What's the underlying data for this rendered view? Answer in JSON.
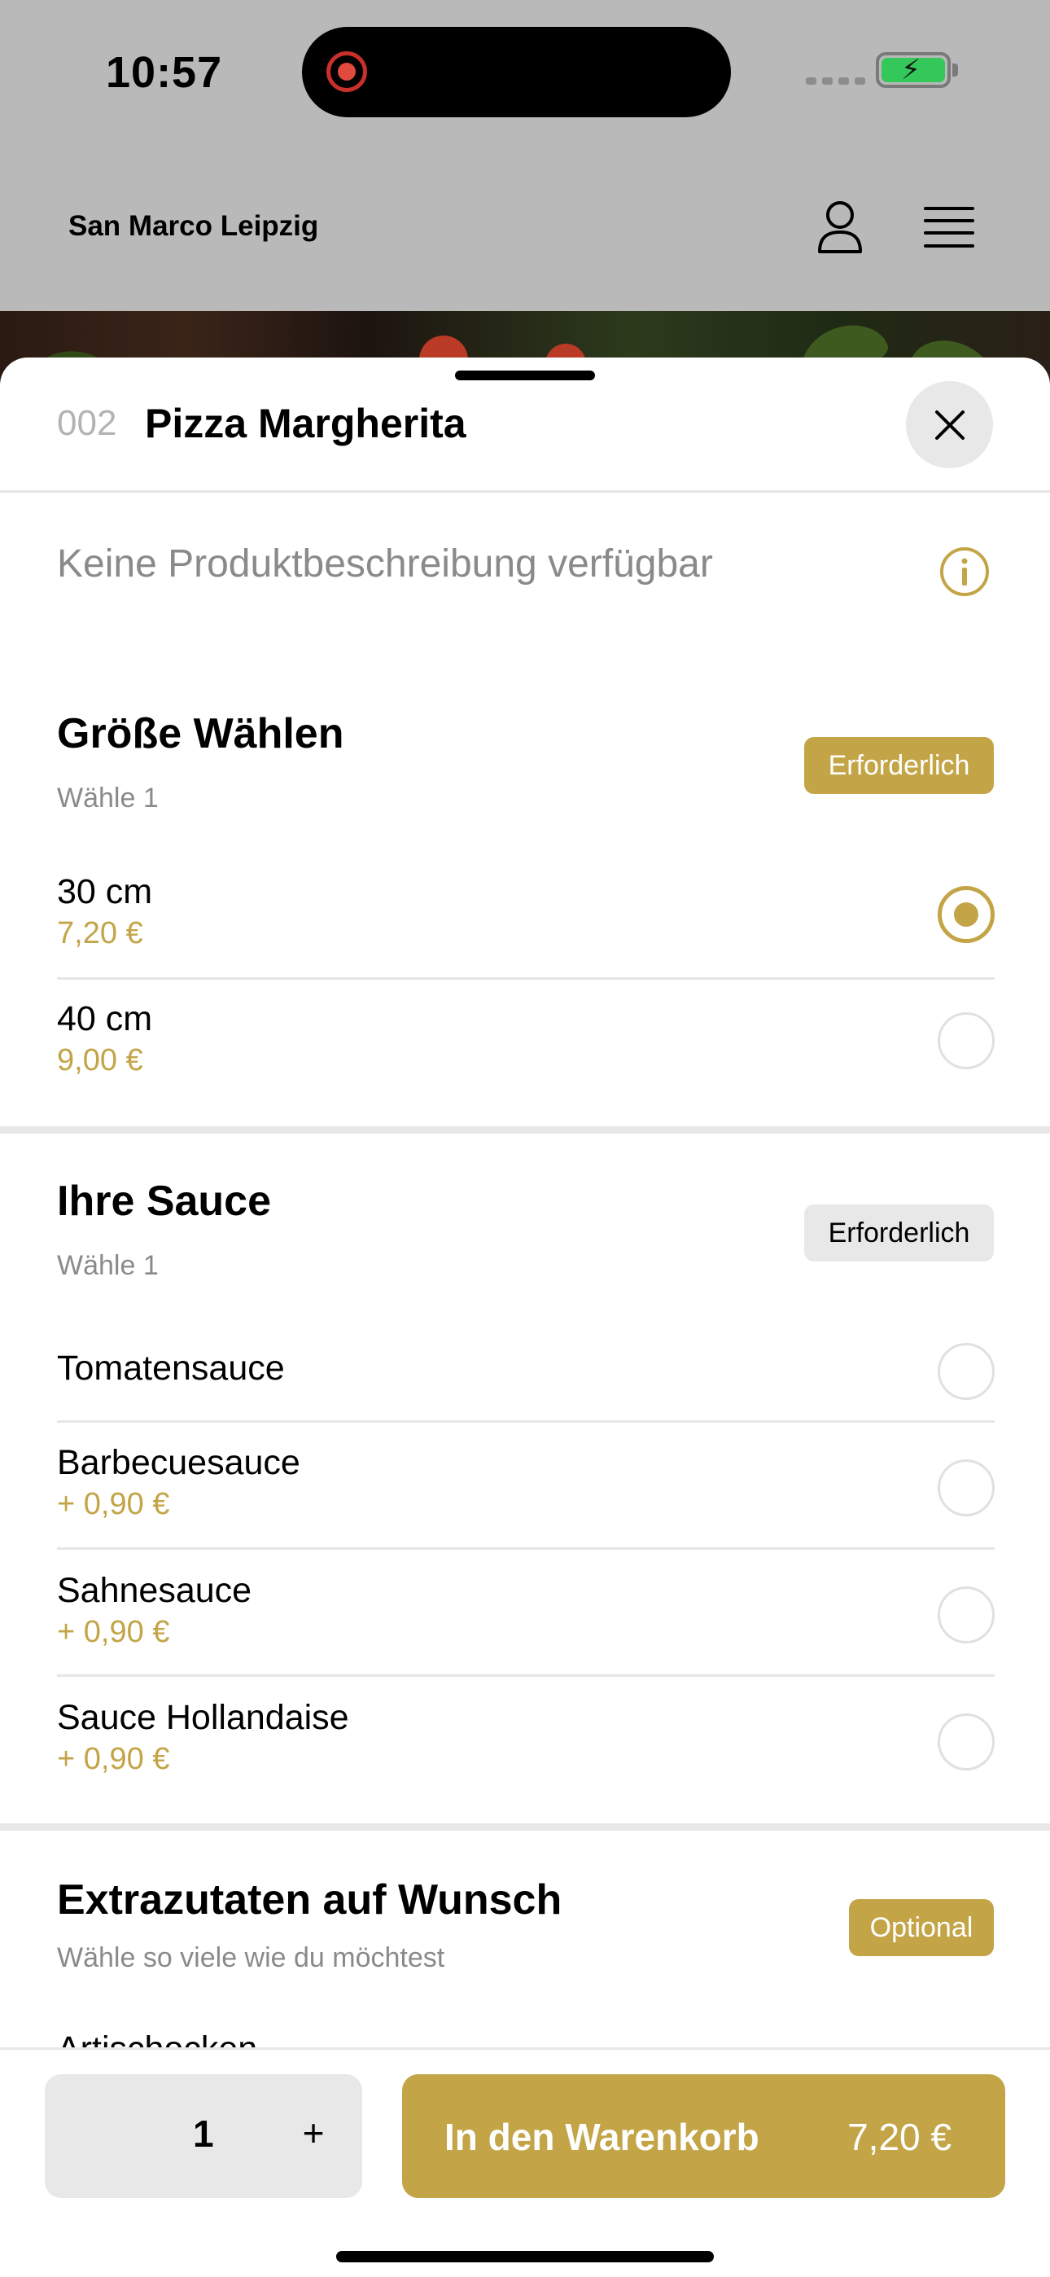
{
  "status": {
    "time": "10:57"
  },
  "header": {
    "brand": "San Marco Leipzig"
  },
  "product": {
    "number": "002",
    "title": "Pizza Margherita",
    "description": "Keine Produktbeschreibung verfügbar"
  },
  "sections": [
    {
      "title": "Größe Wählen",
      "subtitle": "Wähle 1",
      "badge": "Erforderlich",
      "options": [
        {
          "label": "30 cm",
          "price": "7,20 €",
          "selected": true
        },
        {
          "label": "40 cm",
          "price": "9,00 €",
          "selected": false
        }
      ]
    },
    {
      "title": "Ihre Sauce",
      "subtitle": "Wähle 1",
      "badge": "Erforderlich",
      "options": [
        {
          "label": "Tomatensauce",
          "price": "",
          "selected": false
        },
        {
          "label": "Barbecuesauce",
          "price": "+ 0,90 €",
          "selected": false
        },
        {
          "label": "Sahnesauce",
          "price": "+ 0,90 €",
          "selected": false
        },
        {
          "label": "Sauce Hollandaise",
          "price": "+ 0,90 €",
          "selected": false
        }
      ]
    },
    {
      "title": "Extrazutaten auf Wunsch",
      "subtitle": "Wähle so viele wie du möchtest",
      "badge": "Optional",
      "options": [
        {
          "label": "Artischocken",
          "price": "",
          "selected": false
        }
      ]
    }
  ],
  "cart": {
    "quantity": "1",
    "plus": "+",
    "label": "In den Warenkorb",
    "price": "7,20 €"
  },
  "colors": {
    "accent": "#c3a548",
    "badge_grey": "#e8e8e8",
    "battery": "#34c759"
  },
  "icons": [
    "user-icon",
    "menu-icon",
    "close-icon",
    "info-icon",
    "plus-icon"
  ]
}
